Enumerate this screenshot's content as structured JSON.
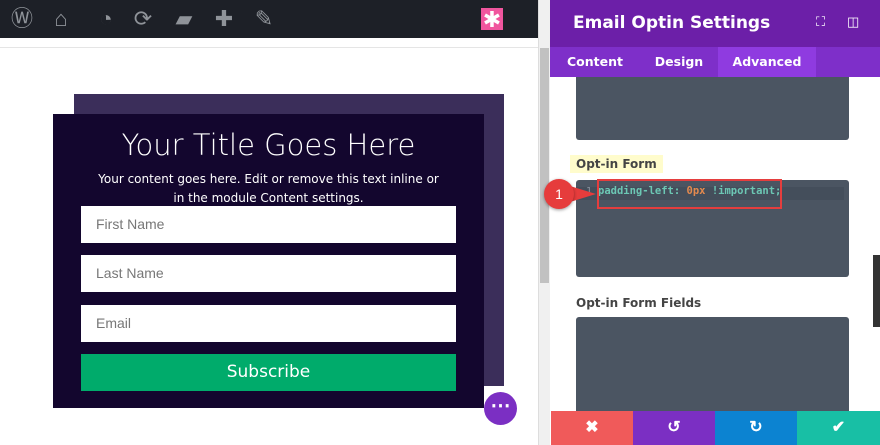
{
  "adminbar": {
    "icons": [
      "wordpress-icon",
      "my-sites-icon",
      "dashboard-icon",
      "updates-icon",
      "comments-icon",
      "new-content-icon",
      "edit-icon",
      "divi-builder-icon"
    ]
  },
  "preview": {
    "title": "Your Title Goes Here",
    "description": "Your content goes here. Edit or remove this text inline or in the module Content settings.",
    "fields": [
      "First Name",
      "Last Name",
      "Email"
    ],
    "button": "Subscribe",
    "more": "⋯"
  },
  "panel": {
    "title": "Email Optin Settings",
    "tabs": [
      "Content",
      "Design",
      "Advanced"
    ],
    "active_tab": "Advanced",
    "sections": [
      {
        "label": "Opt-in Form",
        "line_number": "1",
        "code_property": "padding-left:",
        "code_value": "0px",
        "code_important": "!important;"
      },
      {
        "label": "Opt-in Form Fields"
      }
    ],
    "callout": "1"
  },
  "colors": {
    "header": "#6c1fa8",
    "tabs": "#7e2fc9",
    "cancel": "#f05a5a",
    "undo": "#7b2fc3",
    "redo": "#0c83d1",
    "save": "#18bfa5"
  }
}
